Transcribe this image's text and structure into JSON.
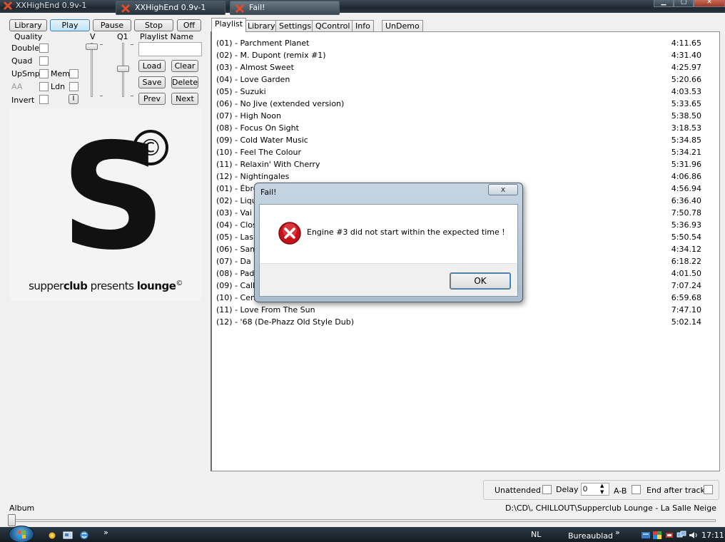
{
  "window": {
    "title": "XXHighEnd 0.9v-1"
  },
  "transport": {
    "library": "Library",
    "play": "Play",
    "pause": "Pause",
    "stop": "Stop",
    "off": "Off"
  },
  "settings": {
    "quality_label": "Quality",
    "v_label": "V",
    "q1_label": "Q1",
    "double": "Double",
    "quad": "Quad",
    "upsmp": "UpSmp",
    "mem": "Mem",
    "aa": "AA",
    "ldn": "Ldn",
    "invert": "Invert",
    "info_btn": "I"
  },
  "playlist_name": {
    "label": "Playlist Name",
    "value": "",
    "load": "Load",
    "clear": "Clear",
    "save": "Save",
    "delete": "Delete",
    "prev": "Prev",
    "next": "Next"
  },
  "album_art": {
    "letter": "S",
    "mark": "©",
    "caption_pre": "supper",
    "caption_club": "club",
    "caption_mid": " presents ",
    "caption_lounge": "lounge",
    "caption_mark": "©"
  },
  "tabs": [
    "Playlist",
    "Library",
    "Settings",
    "QControl",
    "Info",
    "UnDemo"
  ],
  "playlist": [
    {
      "title": "(01) - Parchment Planet",
      "duration": "4:11.65"
    },
    {
      "title": "(02) - M. Dupont (remix #1)",
      "duration": "4:31.40"
    },
    {
      "title": "(03) - Almost Sweet",
      "duration": "4:25.97"
    },
    {
      "title": "(04) - Love Garden",
      "duration": "5:20.66"
    },
    {
      "title": "(05) - Suzuki",
      "duration": "4:03.53"
    },
    {
      "title": "(06) - No Jive (extended version)",
      "duration": "5:33.65"
    },
    {
      "title": "(07) - High Noon",
      "duration": "5:38.50"
    },
    {
      "title": "(08) - Focus On Sight",
      "duration": "3:18.53"
    },
    {
      "title": "(09) - Cold Water Music",
      "duration": "5:34.85"
    },
    {
      "title": "(10) - Feel The Colour",
      "duration": "5:34.21"
    },
    {
      "title": "(11) - Relaxin' With Cherry",
      "duration": "5:31.96"
    },
    {
      "title": "(12) - Nightingales",
      "duration": "4:06.86"
    },
    {
      "title": "(01) - Ébre",
      "duration": "4:56.94"
    },
    {
      "title": "(02) - Liqui",
      "duration": "6:36.40"
    },
    {
      "title": "(03) - Vai M",
      "duration": "7:50.78"
    },
    {
      "title": "(04) - Close",
      "duration": "5:36.93"
    },
    {
      "title": "(05) - Las L",
      "duration": "5:50.54"
    },
    {
      "title": "(06) - Samb",
      "duration": "4:34.12"
    },
    {
      "title": "(07) - Da S",
      "duration": "6:18.22"
    },
    {
      "title": "(08) - Pada",
      "duration": "4:01.50"
    },
    {
      "title": "(09) - Callin",
      "duration": "7:07.24"
    },
    {
      "title": "(10) - Centr",
      "duration": "6:59.68"
    },
    {
      "title": "(11) - Love From The Sun",
      "duration": "7:47.10"
    },
    {
      "title": "(12) - '68 (De-Phazz Old Style Dub)",
      "duration": "5:02.14"
    }
  ],
  "options": {
    "unattended": "Unattended",
    "delay": "Delay",
    "delay_value": "0",
    "ab": "A-B",
    "end_after_track": "End after track"
  },
  "status": {
    "path": "D:\\CD\\, CHILLOUT\\Supperclub Lounge - La Salle Neige",
    "album_label": "Album"
  },
  "dialog": {
    "title": "Fail!",
    "close": "x",
    "message": "Engine #3 did not start within the expected time !",
    "ok": "OK"
  },
  "taskbar": {
    "chevron1": "»",
    "task1": "XXHighEnd 0.9v-1",
    "task2": "Fail!",
    "lang": "NL",
    "desktop": "Bureaublad",
    "chevron2": "»",
    "clock": "17:11"
  },
  "colors": {
    "accent": "#3c7fb1",
    "error_red": "#c8101a",
    "taskbar": "#1c262e"
  }
}
